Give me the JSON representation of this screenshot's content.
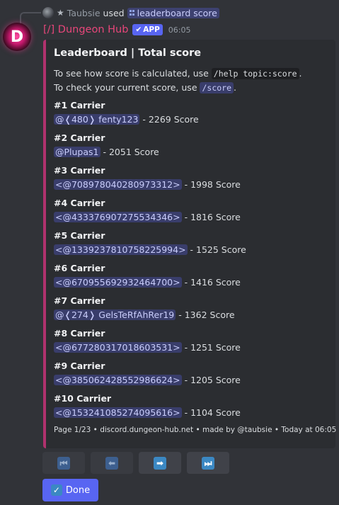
{
  "reply": {
    "user": "Taubsie",
    "used": "used",
    "command": "leaderboard score"
  },
  "message": {
    "author": "[/] Dungeon Hub",
    "badge": "APP",
    "time": "06:05",
    "avatar_letter": "D"
  },
  "embed": {
    "accent_color": "#b0326e",
    "title": "Leaderboard | Total score",
    "desc_line1_pre": "To see how score is calculated, use ",
    "desc_line1_code": "/help topic:score",
    "desc_line1_post": ".",
    "desc_line2_pre": "To check your current score, use ",
    "desc_line2_code": "/score",
    "desc_line2_post": ".",
    "entries": [
      {
        "title": "#1 Carrier",
        "mention": "@❬480❭ fenty123",
        "score": " - 2269 Score"
      },
      {
        "title": "#2 Carrier",
        "mention": "@Plupas1",
        "score": " - 2051 Score"
      },
      {
        "title": "#3 Carrier",
        "mention": "<@708978040280973312>",
        "score": " - 1998 Score"
      },
      {
        "title": "#4 Carrier",
        "mention": "<@433376907275534346>",
        "score": " - 1816 Score"
      },
      {
        "title": "#5 Carrier",
        "mention": "<@1339237810758225994>",
        "score": " - 1525 Score"
      },
      {
        "title": "#6 Carrier",
        "mention": "<@670955692932464700>",
        "score": " - 1416 Score"
      },
      {
        "title": "#7 Carrier",
        "mention": "@❬274❭ GelsTeRfAhRer19",
        "score": " - 1362 Score"
      },
      {
        "title": "#8 Carrier",
        "mention": "<@677280317018603531>",
        "score": " - 1251 Score"
      },
      {
        "title": "#9 Carrier",
        "mention": "<@385062428552986624>",
        "score": " - 1205 Score"
      },
      {
        "title": "#10 Carrier",
        "mention": "<@153241085274095616>",
        "score": " - 1104 Score"
      }
    ],
    "footer": "Page 1/23 • discord.dungeon-hub.net • made by @taubsie • Today at 06:05"
  },
  "buttons": {
    "first_icon": "first-page-icon",
    "prev_icon": "previous-page-icon",
    "next_icon": "next-page-icon",
    "last_icon": "last-page-icon",
    "done_label": "Done"
  },
  "colors": {
    "brand": "#5865f2",
    "author_name": "#e7467a",
    "background": "#313338",
    "embed_bg": "#2b2d31"
  }
}
